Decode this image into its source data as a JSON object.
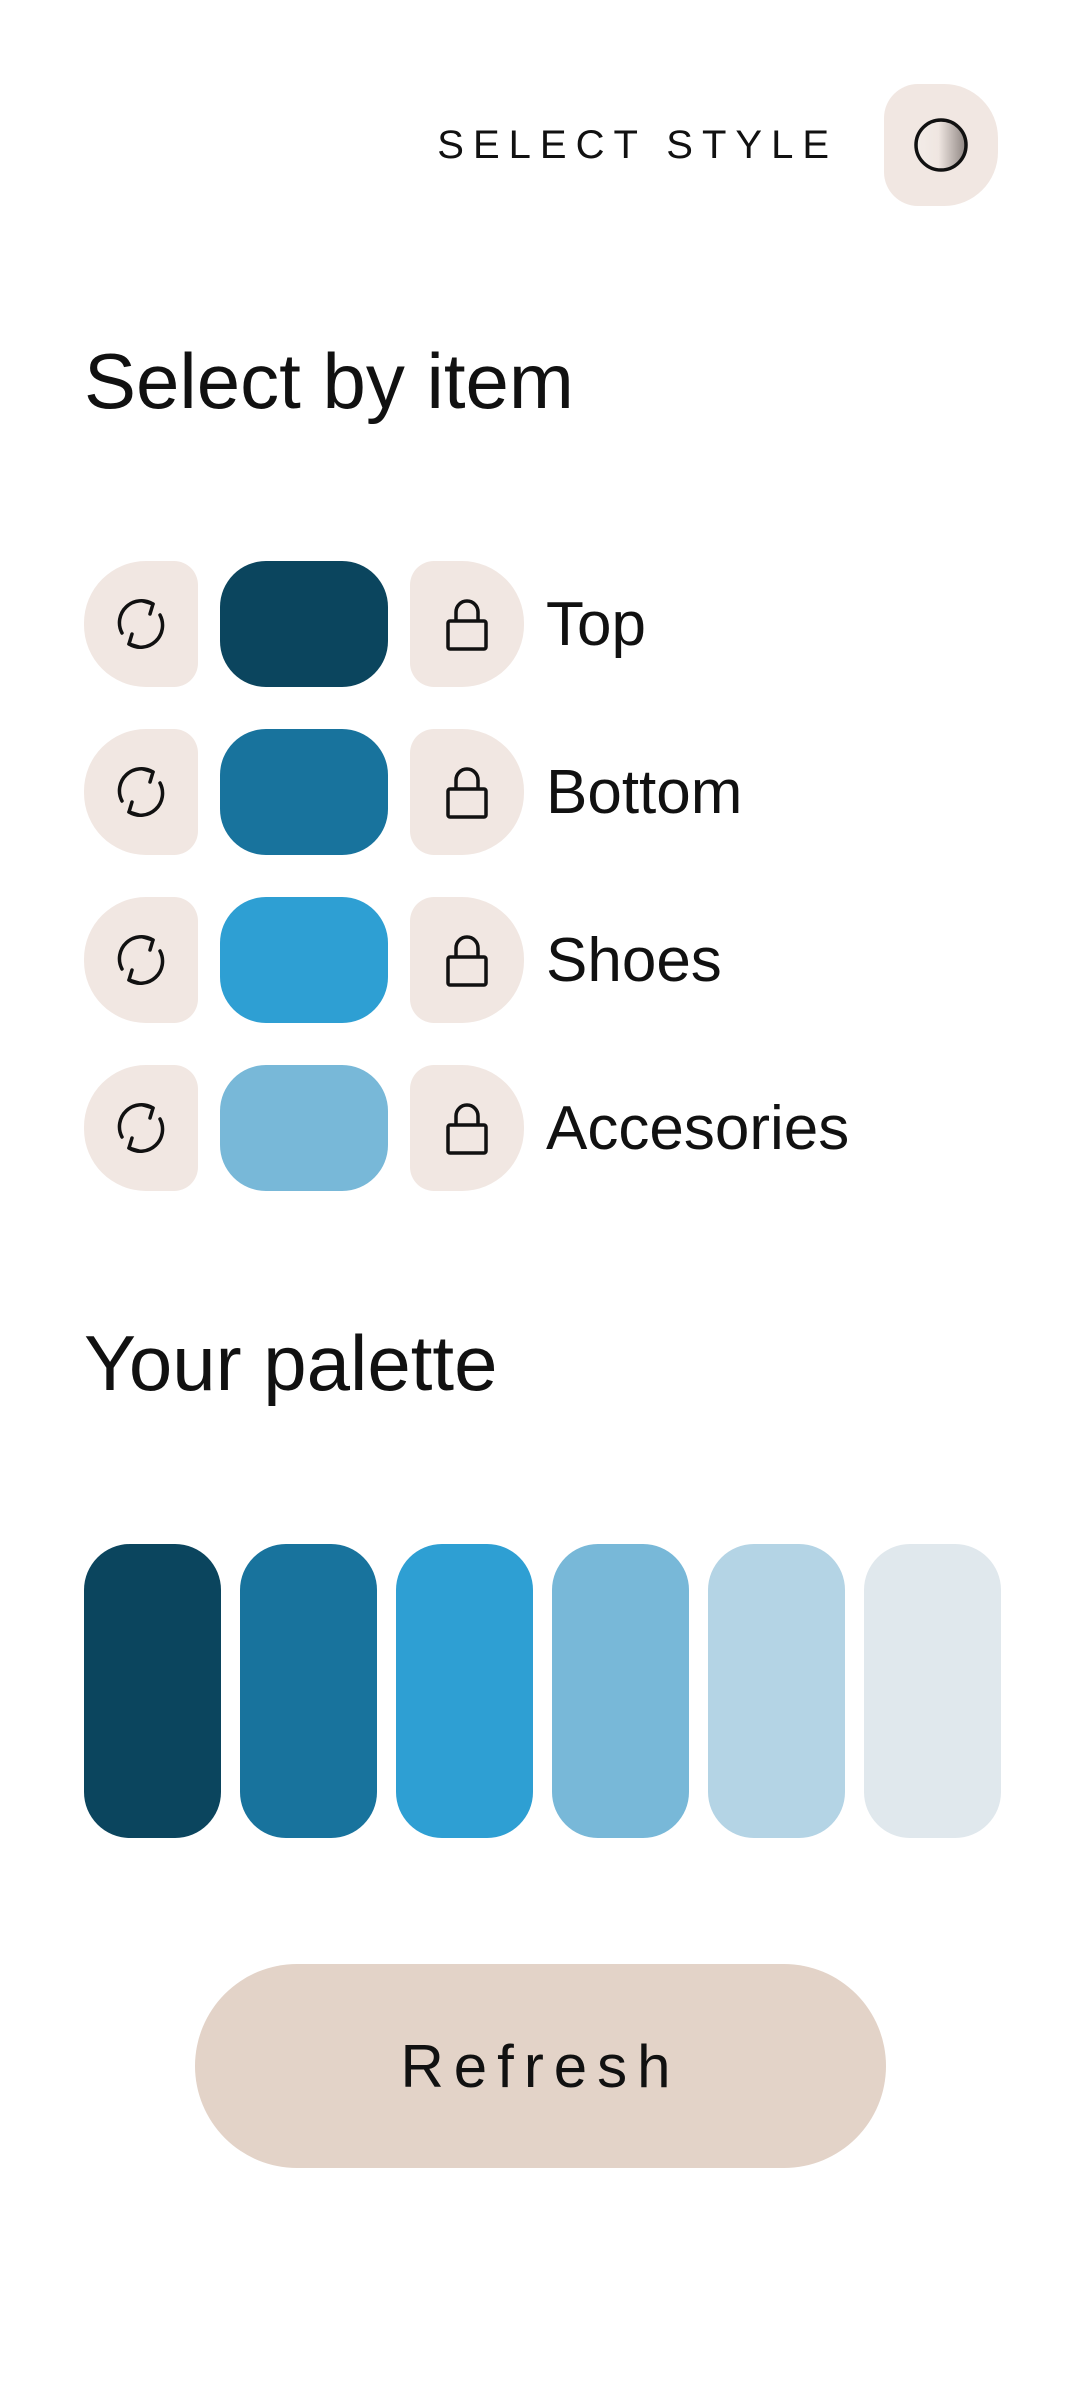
{
  "header": {
    "select_style_label": "SELECT STYLE",
    "style_toggle_icon": "contrast-circle-icon"
  },
  "section_item": {
    "title": "Select by item",
    "items": [
      {
        "label": "Top",
        "color": "#0b455e",
        "shuffle_icon": "refresh-icon",
        "lock_icon": "lock-icon"
      },
      {
        "label": "Bottom",
        "color": "#18739d",
        "shuffle_icon": "refresh-icon",
        "lock_icon": "lock-icon"
      },
      {
        "label": "Shoes",
        "color": "#2e9fd3",
        "shuffle_icon": "refresh-icon",
        "lock_icon": "lock-icon"
      },
      {
        "label": "Accesories",
        "color": "#78b8d8",
        "shuffle_icon": "refresh-icon",
        "lock_icon": "lock-icon"
      }
    ]
  },
  "section_palette": {
    "title": "Your palette",
    "colors": [
      "#0b455e",
      "#18739d",
      "#2e9fd3",
      "#78b8d8",
      "#b4d4e5",
      "#e0e8ed"
    ]
  },
  "refresh": {
    "label": "Refresh"
  },
  "theme": {
    "chip_background": "#f1e7e2",
    "refresh_background": "#e3d3c8"
  }
}
